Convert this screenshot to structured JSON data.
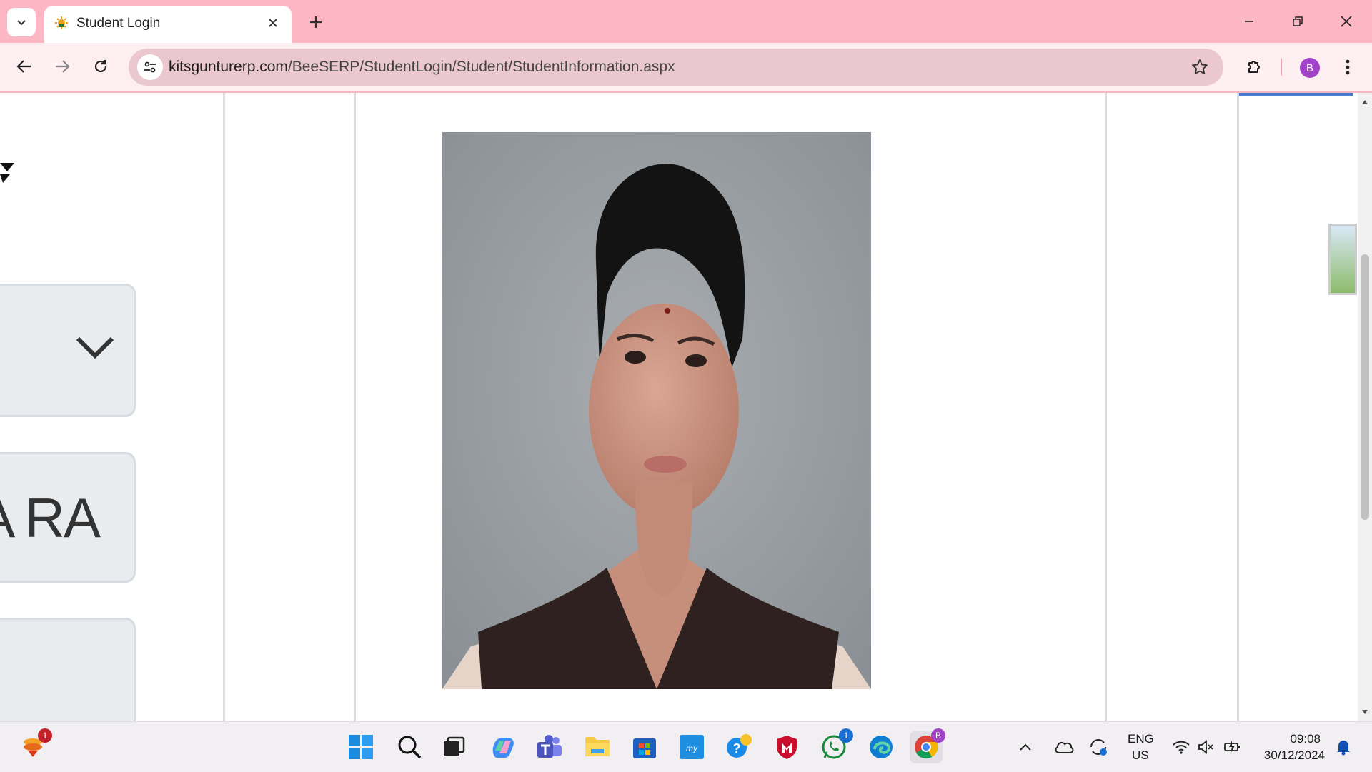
{
  "browser": {
    "tab": {
      "title": "Student Login"
    },
    "address": {
      "host": "kitsgunturerp.com",
      "path": "/BeeSERP/StudentLogin/Student/StudentInformation.aspx"
    },
    "profile_initial": "B"
  },
  "page": {
    "fields": [
      {
        "value": ""
      },
      {
        "value": "A RA"
      },
      {
        "value": ""
      }
    ],
    "photo_alt": "student-photo"
  },
  "taskbar": {
    "notification_badge": "1",
    "whatsapp_badge": "1",
    "chrome_profile": "B",
    "language_line1": "ENG",
    "language_line2": "US",
    "time": "09:08",
    "date": "30/12/2024"
  },
  "colors": {
    "tabbar": "#fdb6c3",
    "toolbar": "#fdeef1",
    "omnibox": "#ebc8d0",
    "accent": "#a142c8"
  }
}
